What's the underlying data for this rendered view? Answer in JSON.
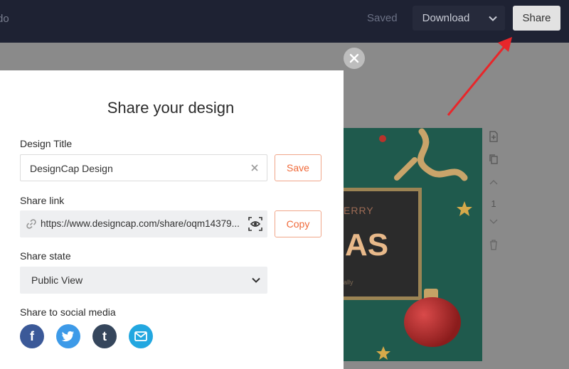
{
  "topbar": {
    "undo_fragment": "do",
    "saved_label": "Saved",
    "download_label": "Download",
    "share_label": "Share"
  },
  "canvas": {
    "merry_text": "ERRY",
    "as_text": "AS",
    "fine_text": "ally",
    "page_number": "1"
  },
  "modal": {
    "title": "Share your design",
    "design_title_label": "Design Title",
    "design_title_value": "DesignCap Design",
    "save_label": "Save",
    "share_link_label": "Share link",
    "share_link_value": "https://www.designcap.com/share/oqm14379...",
    "copy_label": "Copy",
    "share_state_label": "Share state",
    "share_state_value": "Public View",
    "social_label": "Share to social media",
    "social": [
      {
        "icon": "facebook-icon",
        "glyph": "f",
        "color": "#3b5998"
      },
      {
        "icon": "twitter-icon",
        "glyph": "t",
        "color": "#3d9ae8"
      },
      {
        "icon": "tumblr-icon",
        "glyph": "t",
        "color": "#35465c"
      },
      {
        "icon": "email-icon",
        "glyph": "✉",
        "color": "#22a7e0"
      }
    ]
  },
  "colors": {
    "accent": "#f06a3a",
    "topbar": "#1e2233",
    "annotation_arrow": "#e8262a"
  }
}
